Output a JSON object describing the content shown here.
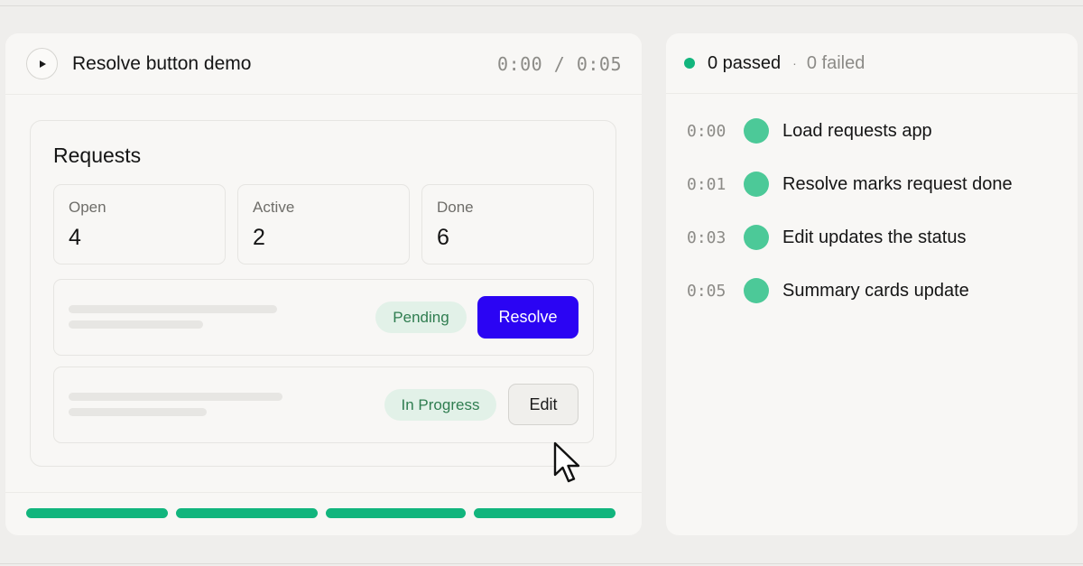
{
  "demo": {
    "title": "Resolve button demo",
    "timer": "0:00 / 0:05",
    "play_icon": "play-icon",
    "progress_segments": [
      {
        "state": "complete"
      },
      {
        "state": "complete"
      },
      {
        "state": "complete"
      },
      {
        "state": "complete"
      }
    ]
  },
  "app": {
    "title": "Requests",
    "stats": [
      {
        "label": "Open",
        "value": "4"
      },
      {
        "label": "Active",
        "value": "2"
      },
      {
        "label": "Done",
        "value": "6"
      }
    ],
    "rows": [
      {
        "status": "Pending",
        "action": "Resolve"
      },
      {
        "status": "In Progress",
        "action": "Edit"
      }
    ]
  },
  "results": {
    "passed": "0 passed",
    "separator": "·",
    "failed": "0 failed",
    "steps": [
      {
        "time": "0:00",
        "name": "Load requests app"
      },
      {
        "time": "0:01",
        "name": "Resolve marks request done"
      },
      {
        "time": "0:03",
        "name": "Edit updates the status"
      },
      {
        "time": "0:05",
        "name": "Summary cards update"
      }
    ]
  },
  "colors": {
    "accent_green": "#12b57d",
    "step_green": "#4cc998",
    "primary_button": "#2b04f3",
    "badge_bg": "#e2f1e8",
    "badge_text": "#2f7d50"
  }
}
